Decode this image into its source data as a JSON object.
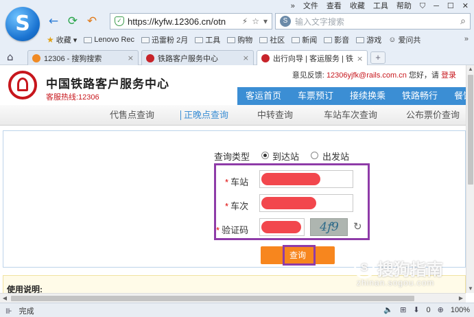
{
  "browser": {
    "top_menu": [
      "»",
      "文件",
      "查看",
      "收藏",
      "工具",
      "帮助"
    ],
    "address": "https://kyfw.12306.cn/otn",
    "search_placeholder": "输入文字搜索",
    "bookmarks": [
      "收藏",
      "Lenovo Rec",
      "迅雷粉 2月",
      "工具",
      "购物",
      "社区",
      "新闻",
      "影音",
      "游戏",
      "爱问共"
    ],
    "bookmarks_more": "»",
    "tabs": [
      {
        "label": "12306 - 搜狗搜索",
        "active": false
      },
      {
        "label": "铁路客户服务中心",
        "active": false
      },
      {
        "label": "出行向导 | 客运服务 | 铁",
        "active": true
      }
    ],
    "tab_close": "×",
    "new_tab": "+"
  },
  "site": {
    "title": "中国铁路客户服务中心",
    "hotline": "客服热线:12306",
    "feedback_label": "意见反馈:",
    "feedback_email": "12306yjfk@rails.com.cn",
    "greeting": "您好，请",
    "login": "登录",
    "main_nav": [
      "客运首页",
      "车票预订",
      "接续换乘",
      "铁路畅行",
      "餐饮"
    ],
    "sub_nav": [
      "代售点查询",
      "正晚点查询",
      "中转查询",
      "车站车次查询",
      "公布票价查询"
    ],
    "sub_nav_active": "正晚点查询"
  },
  "form": {
    "query_type_label": "查询类型",
    "options": [
      {
        "label": "到达站",
        "checked": true
      },
      {
        "label": "出发站",
        "checked": false
      }
    ],
    "required_mark": "*",
    "station_label": "车站",
    "train_label": "车次",
    "captcha_label": "验证码",
    "captcha_text": "4ꝭ9",
    "submit_label": "查询"
  },
  "usage": {
    "title": "使用说明:"
  },
  "watermark": {
    "logo": "S",
    "main": "搜狗指南",
    "sub": "zhinan.sogou.com"
  },
  "status_bar": {
    "status": "完成",
    "badge": "0",
    "zoom": "100%"
  },
  "colors": {
    "brand_red": "#c7161c",
    "nav_blue": "#3b8ed4",
    "button_orange": "#f7861e",
    "highlight_purple": "#8e3ba8"
  }
}
